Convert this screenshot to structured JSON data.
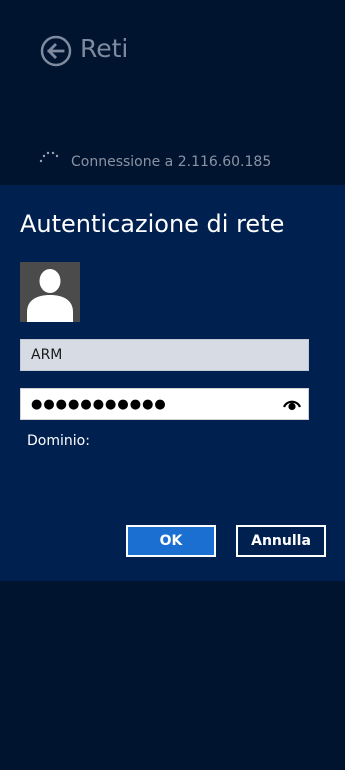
{
  "header": {
    "title": "Reti",
    "back_icon": "back-arrow-icon"
  },
  "status": {
    "text": "Connessione a 2.116.60.185",
    "icon": "loading-spinner-icon"
  },
  "dialog": {
    "title": "Autenticazione di rete",
    "avatar_icon": "user-avatar-icon",
    "username_value": "ARM",
    "password_masked": "●●●●●●●●●●●",
    "reveal_icon": "eye-icon",
    "domain_label": "Dominio:",
    "ok_label": "OK",
    "cancel_label": "Annulla"
  },
  "colors": {
    "background": "#00112c",
    "dialog_background": "#002050",
    "ok_button": "#1a6fd0",
    "username_field": "#d7dbe4"
  }
}
